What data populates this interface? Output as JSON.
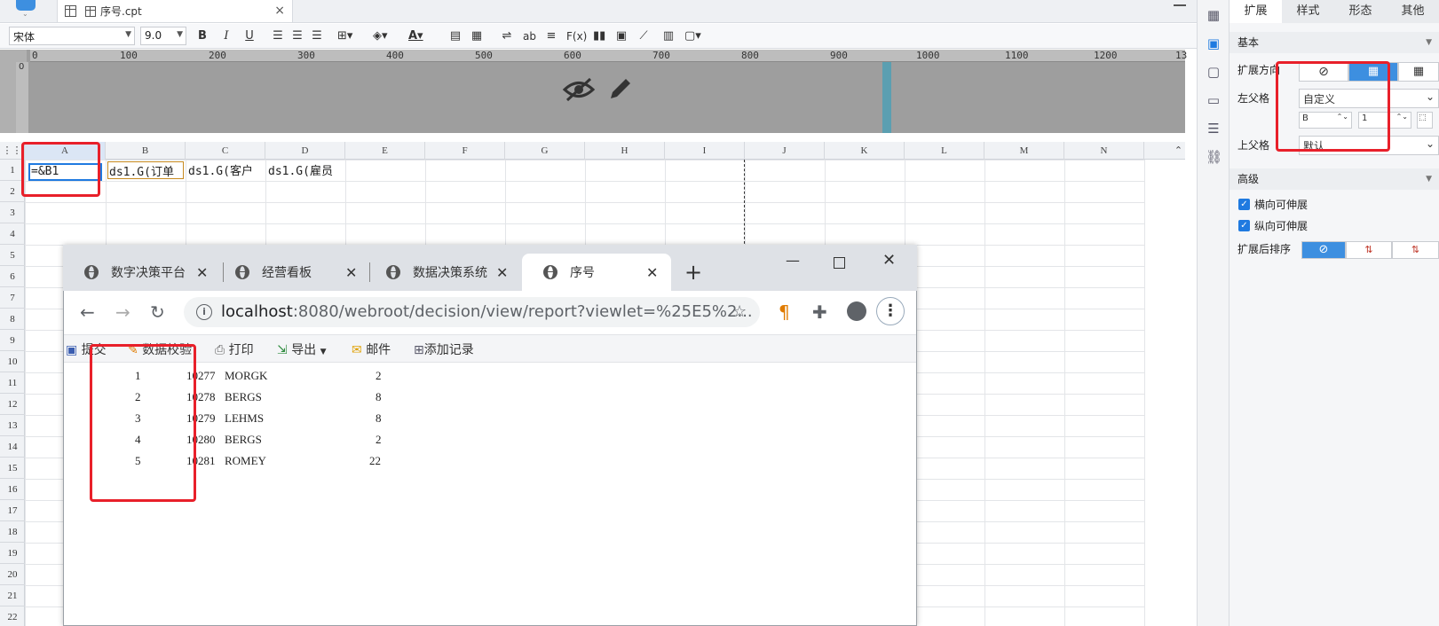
{
  "editor": {
    "file_tab": "序号.cpt",
    "close": "×",
    "font_name": "宋体",
    "font_size": "9.0",
    "bold": "B",
    "italic": "I",
    "underline": "U",
    "fx": "F(x)",
    "ab": "ab",
    "ruler_ticks": [
      "0",
      "100",
      "200",
      "300",
      "400",
      "500",
      "600",
      "700",
      "800",
      "900",
      "1000",
      "1100",
      "1200",
      "13"
    ],
    "vruler_label": "0",
    "columns": [
      "A",
      "B",
      "C",
      "D",
      "E",
      "F",
      "G",
      "H",
      "I",
      "J",
      "K",
      "L",
      "M",
      "N"
    ],
    "rows": [
      "1",
      "2",
      "3",
      "4",
      "5",
      "6",
      "7",
      "8",
      "9",
      "10",
      "11",
      "12",
      "13",
      "14",
      "15",
      "16",
      "17",
      "18",
      "19",
      "20",
      "21",
      "22"
    ],
    "cells": {
      "a1": "=&B1",
      "b1": "ds1.G(订单",
      "c1": "ds1.G(客户",
      "d1": "ds1.G(雇员"
    }
  },
  "panel": {
    "tabs": [
      "扩展",
      "样式",
      "形态",
      "其他"
    ],
    "basic": "基本",
    "direction": "扩展方向",
    "left_parent": "左父格",
    "left_parent_value": "自定义",
    "left_col": "B",
    "left_row": "1",
    "top_parent": "上父格",
    "top_parent_value": "默认",
    "advanced": "高级",
    "h_extend": "横向可伸展",
    "v_extend": "纵向可伸展",
    "sort_after": "扩展后排序"
  },
  "browser": {
    "tabs": [
      "数字决策平台",
      "经营看板",
      "数据决策系统",
      "序号"
    ],
    "new_tab": "+",
    "url_host": "localhost",
    "url_rest": ":8080/webroot/decision/view/report?viewlet=%25E5%2...",
    "toolbar": [
      "提交",
      "数据校验",
      "打印",
      "导出",
      "邮件",
      "添加记录"
    ],
    "rows": [
      {
        "seq": "1",
        "id": "10277",
        "cust": "MORGK",
        "emp": "2"
      },
      {
        "seq": "2",
        "id": "10278",
        "cust": "BERGS",
        "emp": "8"
      },
      {
        "seq": "3",
        "id": "10279",
        "cust": "LEHMS",
        "emp": "8"
      },
      {
        "seq": "4",
        "id": "10280",
        "cust": "BERGS",
        "emp": "2"
      },
      {
        "seq": "5",
        "id": "10281",
        "cust": "ROMEY",
        "emp": "22"
      }
    ]
  },
  "colors": {
    "red": "#e8202a",
    "accent": "#1f7ae0",
    "teal": "#4a9fb5"
  }
}
